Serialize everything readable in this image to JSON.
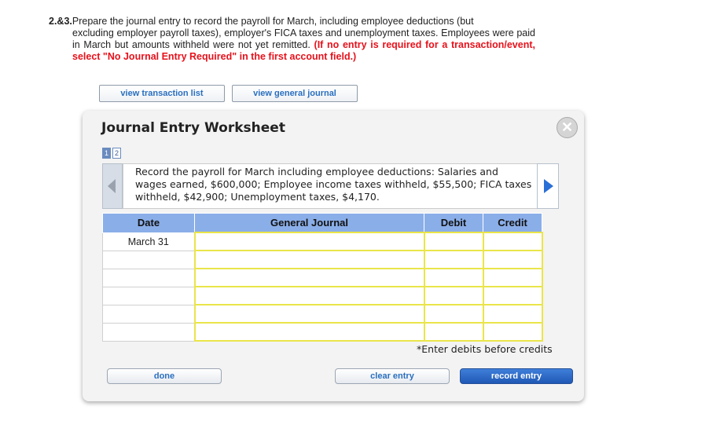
{
  "question": {
    "number": "2.&3.",
    "text_line1": "Prepare the journal entry to record the payroll for March, including employee deductions (but",
    "text_rest": "excluding employer payroll taxes), employer's FICA taxes and unemployment taxes. Employees were paid in March but amounts withheld were not yet remitted.",
    "instruction": "(If no entry is required for a transaction/event, select \"No Journal Entry Required\" in the first account field.)"
  },
  "top_buttons": {
    "view_transaction_list": "view transaction list",
    "view_general_journal": "view general journal"
  },
  "worksheet": {
    "title": "Journal Entry Worksheet",
    "close_glyph": "✕",
    "pages": [
      "1",
      "2"
    ],
    "description": "Record the payroll for March including employee deductions: Salaries and wages earned, $600,000; Employee income taxes withheld, $55,500; FICA taxes withheld, $42,900; Unemployment taxes, $4,170.",
    "table": {
      "headers": [
        "Date",
        "General Journal",
        "Debit",
        "Credit"
      ],
      "rows": [
        {
          "date": "March 31"
        },
        {
          "date": ""
        },
        {
          "date": ""
        },
        {
          "date": ""
        },
        {
          "date": ""
        },
        {
          "date": ""
        }
      ]
    },
    "hint": "*Enter debits before credits",
    "buttons": {
      "done": "done",
      "clear_entry": "clear entry",
      "record_entry": "record entry"
    }
  },
  "colors": {
    "header_blue": "#8aaee8",
    "instruction_red": "#e8111b",
    "input_border_yellow": "#eae54a",
    "record_button_blue": "#1f58b5"
  }
}
